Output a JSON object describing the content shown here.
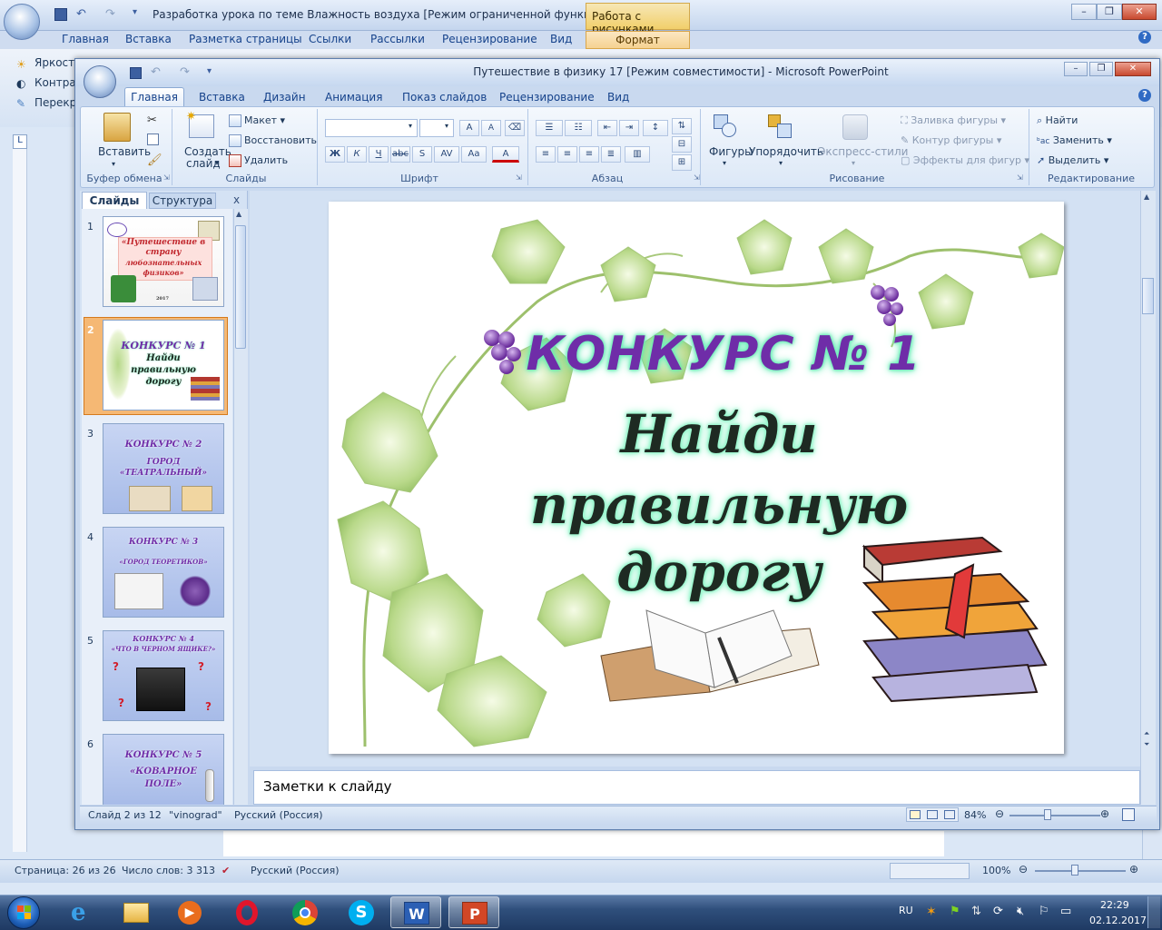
{
  "word": {
    "title": "Разработка урока по теме Влажность воздуха [Режим ограниченной функционал...",
    "context_tab": "Работа с рисунками",
    "tabs": [
      "Главная",
      "Вставка",
      "Разметка страницы",
      "Ссылки",
      "Рассылки",
      "Рецензирование",
      "Вид"
    ],
    "format_tab": "Формат",
    "ribbon_items": [
      "Яркость",
      "Контрас",
      "Перекра"
    ],
    "status": {
      "page": "Страница: 26 из 26",
      "words": "Число слов: 3 313",
      "language": "Русский (Россия)",
      "zoom": "100%"
    }
  },
  "ppt": {
    "title": "Путешествие  в физику 17 [Режим совместимости] - Microsoft PowerPoint",
    "tabs": [
      "Главная",
      "Вставка",
      "Дизайн",
      "Анимация",
      "Показ слайдов",
      "Рецензирование",
      "Вид"
    ],
    "ribbon": {
      "clipboard": {
        "paste": "Вставить",
        "label": "Буфер обмена"
      },
      "slides": {
        "new_slide_1": "Создать",
        "new_slide_2": "слайд",
        "layout": "Макет",
        "reset": "Восстановить",
        "delete": "Удалить",
        "label": "Слайды"
      },
      "font": {
        "label": "Шрифт",
        "bold": "Ж",
        "italic": "К",
        "underline": "Ч",
        "strike": "abc",
        "shadow": "S",
        "spacing": "AV",
        "case": "Aa",
        "grow": "A",
        "shrink": "A",
        "color": "A"
      },
      "paragraph": {
        "label": "Абзац"
      },
      "drawing": {
        "shapes": "Фигуры",
        "arrange": "Упорядочить",
        "quick_styles": "Экспресс-стили",
        "fill": "Заливка фигуры",
        "outline": "Контур фигуры",
        "effects": "Эффекты для фигур",
        "label": "Рисование"
      },
      "editing": {
        "find": "Найти",
        "replace": "Заменить",
        "select": "Выделить",
        "label": "Редактирование"
      }
    },
    "panel_tabs": {
      "slides": "Слайды",
      "outline": "Структура",
      "close": "x"
    },
    "thumbnails": [
      {
        "num": "1",
        "lines": [
          "«Путешествие в",
          "страну",
          "любознательных",
          "физиков»"
        ],
        "footer": "2017"
      },
      {
        "num": "2",
        "lines": [
          "КОНКУРС № 1",
          "Найди",
          "правильную",
          "дорогу"
        ]
      },
      {
        "num": "3",
        "lines": [
          "КОНКУРС № 2",
          "ГОРОД",
          "«ТЕАТРАЛЬНЫЙ»"
        ]
      },
      {
        "num": "4",
        "lines": [
          "КОНКУРС № 3",
          "«ГОРОД ТЕОРЕТИКОВ»"
        ]
      },
      {
        "num": "5",
        "lines": [
          "КОНКУРС № 4",
          "«ЧТО В ЧЕРНОМ ЯЩИКЕ?»"
        ]
      },
      {
        "num": "6",
        "lines": [
          "КОНКУРС № 5",
          "«КОВАРНОЕ",
          "ПОЛЕ»"
        ]
      }
    ],
    "slide": {
      "title": "КОНКУРС № 1",
      "line1": "Найди",
      "line2": "правильную",
      "line3": "дорогу"
    },
    "notes": "Заметки к слайду",
    "status": {
      "slide": "Слайд 2 из 12",
      "theme": "\"vinograd\"",
      "language": "Русский (Россия)",
      "zoom": "84%"
    }
  },
  "taskbar": {
    "lang": "RU",
    "time": "22:29",
    "date": "02.12.2017"
  }
}
